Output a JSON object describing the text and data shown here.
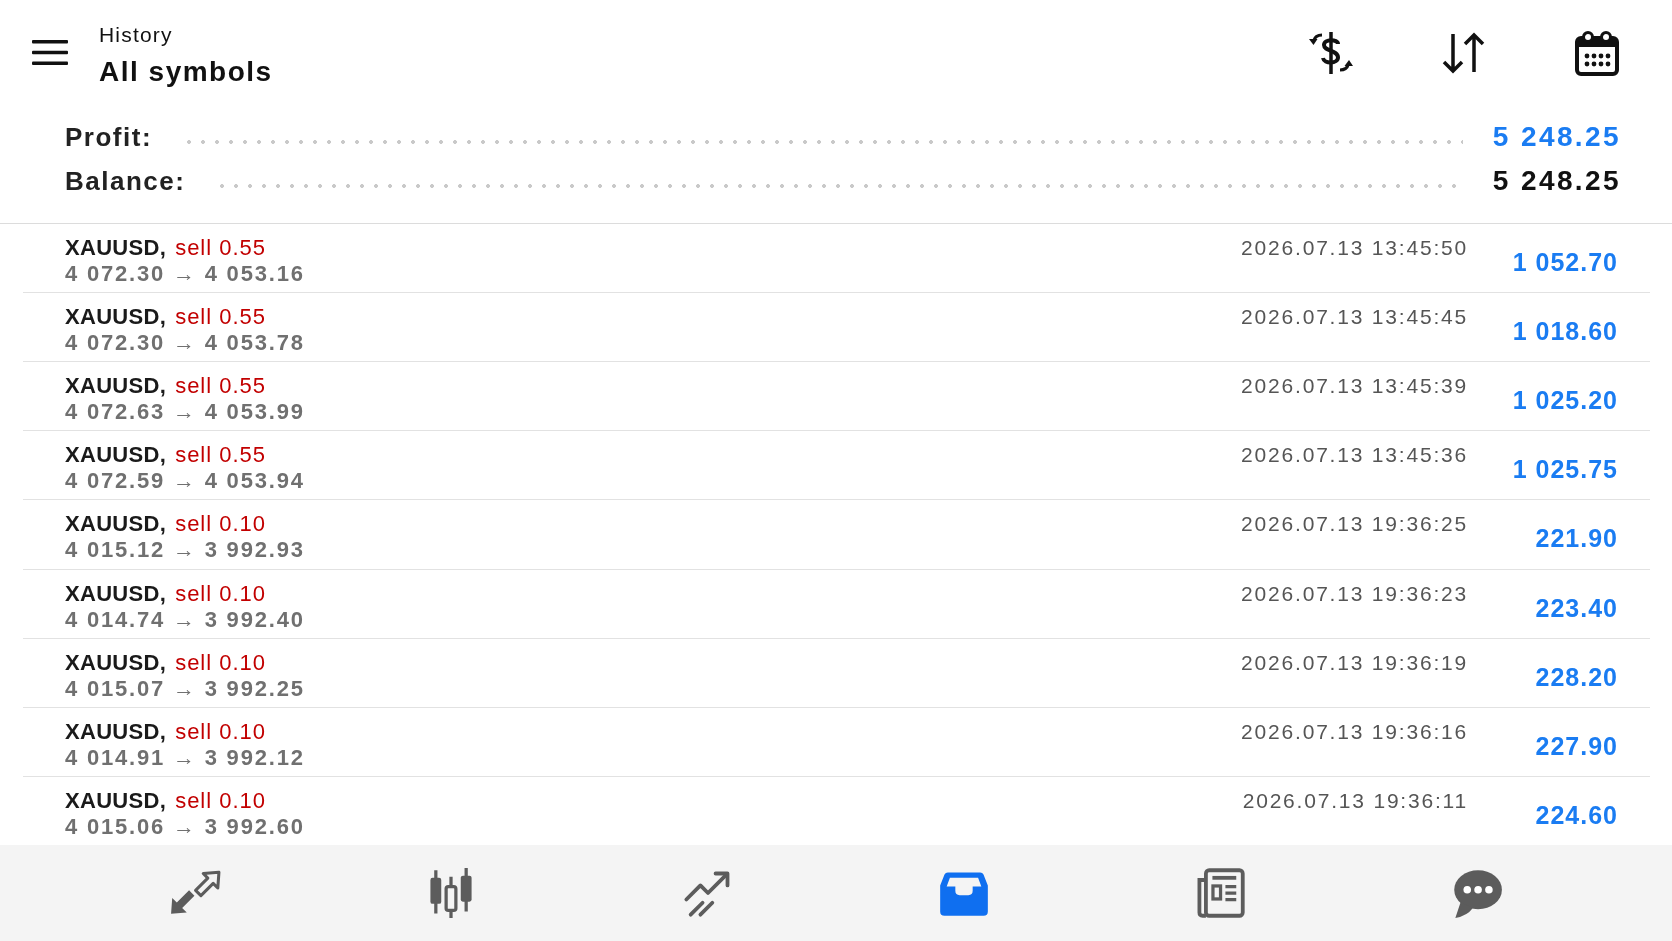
{
  "header": {
    "subtitle": "History",
    "title": "All symbols"
  },
  "summary": {
    "profit": {
      "label": "Profit:",
      "value": "5 248.25"
    },
    "balance": {
      "label": "Balance:",
      "value": "5 248.25"
    }
  },
  "deals": [
    {
      "symbol": "XAUUSD,",
      "order": "sell 0.55",
      "prices": "4 072.30 → 4 053.16",
      "time": "2026.07.13 13:45:50",
      "profit": "1 052.70"
    },
    {
      "symbol": "XAUUSD,",
      "order": "sell 0.55",
      "prices": "4 072.30 → 4 053.78",
      "time": "2026.07.13 13:45:45",
      "profit": "1 018.60"
    },
    {
      "symbol": "XAUUSD,",
      "order": "sell 0.55",
      "prices": "4 072.63 → 4 053.99",
      "time": "2026.07.13 13:45:39",
      "profit": "1 025.20"
    },
    {
      "symbol": "XAUUSD,",
      "order": "sell 0.55",
      "prices": "4 072.59 → 4 053.94",
      "time": "2026.07.13 13:45:36",
      "profit": "1 025.75"
    },
    {
      "symbol": "XAUUSD,",
      "order": "sell 0.10",
      "prices": "4 015.12 → 3 992.93",
      "time": "2026.07.13 19:36:25",
      "profit": "221.90"
    },
    {
      "symbol": "XAUUSD,",
      "order": "sell 0.10",
      "prices": "4 014.74 → 3 992.40",
      "time": "2026.07.13 19:36:23",
      "profit": "223.40"
    },
    {
      "symbol": "XAUUSD,",
      "order": "sell 0.10",
      "prices": "4 015.07 → 3 992.25",
      "time": "2026.07.13 19:36:19",
      "profit": "228.20"
    },
    {
      "symbol": "XAUUSD,",
      "order": "sell 0.10",
      "prices": "4 014.91 → 3 992.12",
      "time": "2026.07.13 19:36:16",
      "profit": "227.90"
    },
    {
      "symbol": "XAUUSD,",
      "order": "sell 0.10",
      "prices": "4 015.06 → 3 992.60",
      "time": "2026.07.13 19:36:11",
      "profit": "224.60"
    }
  ],
  "bottom_nav": [
    {
      "selected": false
    },
    {
      "selected": false
    },
    {
      "selected": false
    },
    {
      "selected": true
    },
    {
      "selected": false
    },
    {
      "selected": false
    }
  ]
}
